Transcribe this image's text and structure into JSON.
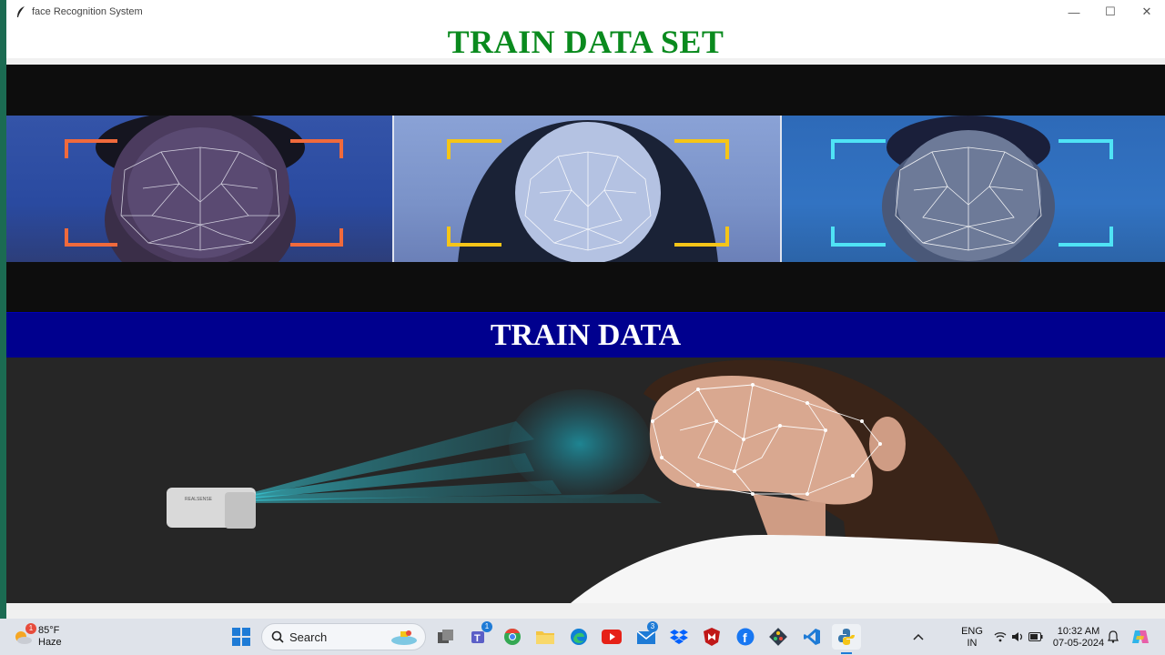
{
  "window": {
    "title": "face Recognition System"
  },
  "header": {
    "title": "TRAIN DATA SET"
  },
  "band": {
    "label": "TRAIN DATA"
  },
  "scene": {
    "device_label": "REALSENSE"
  },
  "taskbar": {
    "weather_temp": "85°F",
    "weather_desc": "Haze",
    "weather_badge": "1",
    "search_placeholder": "Search",
    "teams_badge": "1",
    "mail_badge": "3",
    "lang_line1": "ENG",
    "lang_line2": "IN",
    "time": "10:32 AM",
    "date": "07-05-2024"
  },
  "colors": {
    "header_text": "#0a8a1e",
    "band_bg": "#00008e",
    "frame_orange": "#f06a3c",
    "frame_yellow": "#f5c518",
    "frame_cyan": "#4fe3f5"
  },
  "icons": [
    "feather-icon",
    "minimize-icon",
    "maximize-icon",
    "close-icon",
    "windows-start-icon",
    "search-icon",
    "task-view-icon",
    "teams-icon",
    "chrome-icon",
    "file-explorer-icon",
    "edge-icon",
    "youtube-icon",
    "mail-icon",
    "dropbox-icon",
    "mcafee-icon",
    "facebook-icon",
    "git-icon",
    "vscode-icon",
    "python-icon",
    "chevron-up-icon",
    "wifi-icon",
    "speaker-icon",
    "battery-icon",
    "bell-icon",
    "copilot-icon"
  ]
}
